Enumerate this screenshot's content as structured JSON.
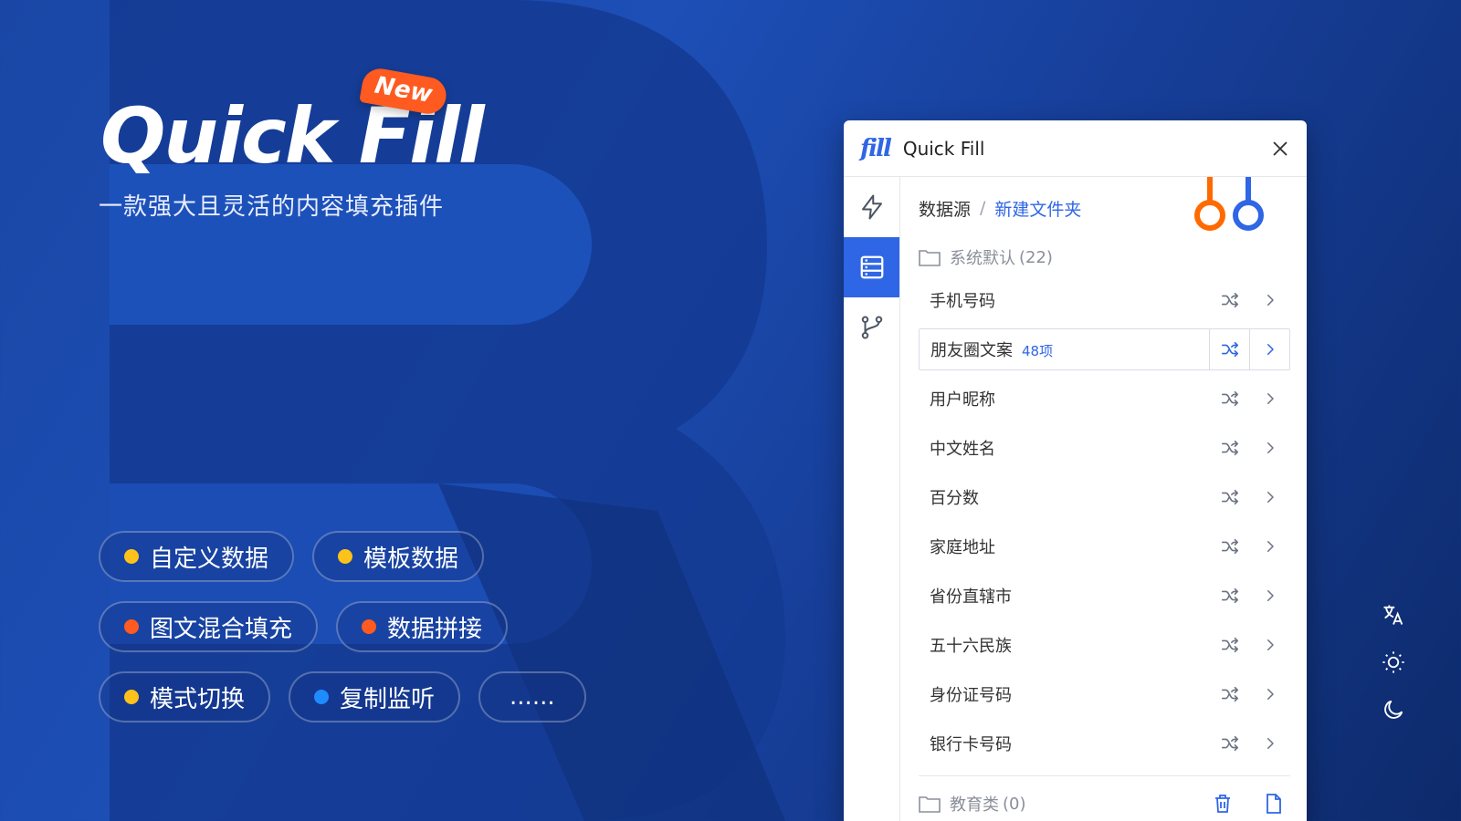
{
  "hero": {
    "title": "Quick Fill",
    "badge": "New",
    "subtitle": "一款强大且灵活的内容填充插件"
  },
  "tags": [
    [
      {
        "label": "自定义数据",
        "color": "#ffc21a"
      },
      {
        "label": "模板数据",
        "color": "#ffc21a"
      }
    ],
    [
      {
        "label": "图文混合填充",
        "color": "#ff5a1f"
      },
      {
        "label": "数据拼接",
        "color": "#ff5a1f"
      }
    ],
    [
      {
        "label": "模式切换",
        "color": "#ffc21a"
      },
      {
        "label": "复制监听",
        "color": "#1e8bff"
      },
      {
        "label": "......",
        "color": ""
      }
    ]
  ],
  "panel": {
    "logo": "fill",
    "title": "Quick Fill",
    "breadcrumb": {
      "root": "数据源",
      "sep": "/",
      "current": "新建文件夹"
    },
    "groups": [
      {
        "name": "系统默认",
        "count": "(22)",
        "items": [
          {
            "label": "手机号码"
          },
          {
            "label": "朋友圈文案",
            "badge": "48项",
            "selected": true
          },
          {
            "label": "用户昵称"
          },
          {
            "label": "中文姓名"
          },
          {
            "label": "百分数"
          },
          {
            "label": "家庭地址"
          },
          {
            "label": "省份直辖市"
          },
          {
            "label": "五十六民族"
          },
          {
            "label": "身份证号码"
          },
          {
            "label": "银行卡号码"
          }
        ]
      },
      {
        "name": "教育类",
        "count": "(0)",
        "items": []
      }
    ]
  },
  "colors": {
    "accent": "#2f66e6",
    "orange": "#ff6a00",
    "bg": "#1d4fb7"
  },
  "icons": [
    "lightning-icon",
    "database-icon",
    "branch-icon",
    "close-icon",
    "shuffle-icon",
    "chevron-right-icon",
    "folder-icon",
    "trash-icon",
    "file-icon",
    "translate-icon",
    "sun-icon",
    "moon-icon"
  ]
}
